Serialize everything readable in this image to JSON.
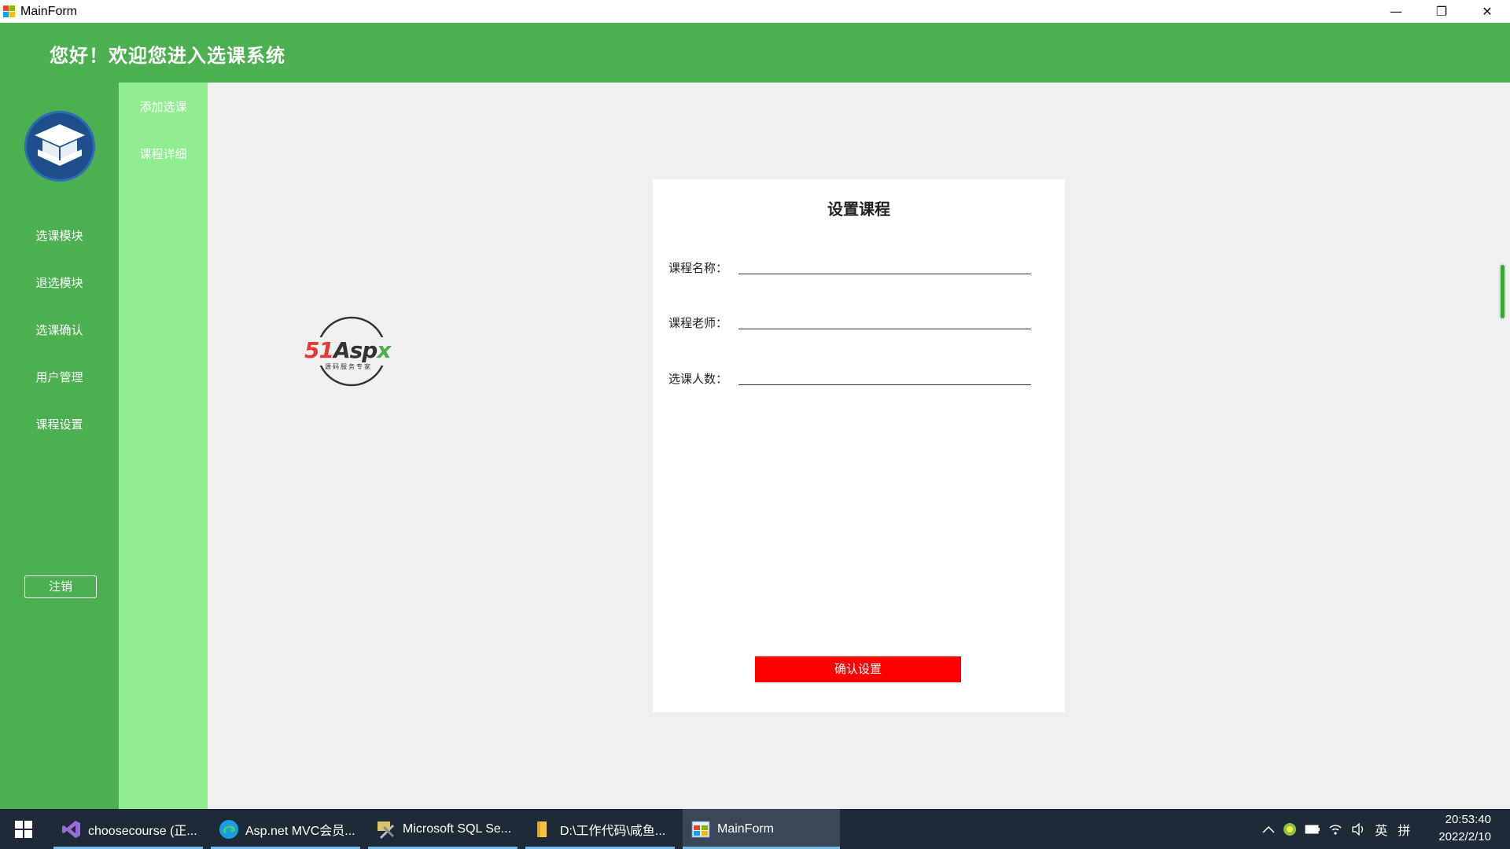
{
  "window": {
    "title": "MainForm",
    "controls": {
      "minimize": "—",
      "restore": "❐",
      "close": "✕"
    }
  },
  "header": {
    "welcome": "您好！欢迎您进入选课系统"
  },
  "leftnav": {
    "items": [
      "选课模块",
      "退选模块",
      "选课确认",
      "用户管理",
      "课程设置"
    ],
    "logout": "注销"
  },
  "subnav": {
    "items": [
      "添加选课",
      "课程详细"
    ]
  },
  "watermark": {
    "brand_red": "51",
    "brand_dark": "Asp",
    "brand_green": "x",
    "tagline": "源码服务专家"
  },
  "form": {
    "title": "设置课程",
    "fields": [
      {
        "label": "课程名称：",
        "value": ""
      },
      {
        "label": "课程老师：",
        "value": ""
      },
      {
        "label": "选课人数：",
        "value": ""
      }
    ],
    "confirm": "确认设置"
  },
  "taskbar": {
    "tasks": [
      {
        "label": "choosecourse (正...",
        "icon": "visual-studio-icon"
      },
      {
        "label": "Asp.net MVC会员...",
        "icon": "edge-icon"
      },
      {
        "label": "Microsoft SQL Se...",
        "icon": "sql-server-icon"
      },
      {
        "label": "D:\\工作代码\\咸鱼...",
        "icon": "folder-icon"
      },
      {
        "label": "MainForm",
        "icon": "app-icon"
      }
    ],
    "tray": {
      "ime_lang": "英",
      "ime_mode": "拼"
    },
    "clock": {
      "time": "20:53:40",
      "date": "2022/2/10"
    }
  },
  "colors": {
    "header_green": "#4caf50",
    "subnav_green": "#90ee90",
    "confirm_red": "#ff0000",
    "taskbar": "#1f2a38"
  }
}
